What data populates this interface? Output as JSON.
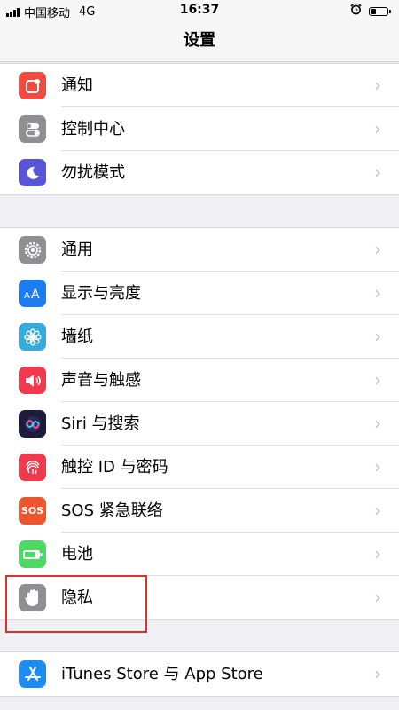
{
  "status_bar": {
    "carrier": "中国移动",
    "network": "4G",
    "time": "16:37",
    "alarm_icon": "alarm-clock-icon",
    "battery_level": 0.35
  },
  "nav": {
    "title": "设置"
  },
  "groups": [
    {
      "items": [
        {
          "label": "通知",
          "icon": "notification-icon",
          "color": "#f04b3f"
        },
        {
          "label": "控制中心",
          "icon": "toggles-icon",
          "color": "#8e8e93"
        },
        {
          "label": "勿扰模式",
          "icon": "moon-icon",
          "color": "#5856d6"
        }
      ]
    },
    {
      "items": [
        {
          "label": "通用",
          "icon": "gear-icon",
          "color": "#8e8e93"
        },
        {
          "label": "显示与亮度",
          "icon": "text-size-icon",
          "color": "#1d7cf2"
        },
        {
          "label": "墙纸",
          "icon": "flower-icon",
          "color": "#35aadc"
        },
        {
          "label": "声音与触感",
          "icon": "speaker-icon",
          "color": "#f1394e"
        },
        {
          "label": "Siri 与搜索",
          "icon": "siri-icon",
          "color": "#1c1c3a"
        },
        {
          "label": "触控 ID 与密码",
          "icon": "fingerprint-icon",
          "color": "#f0394c"
        },
        {
          "label": "SOS 紧急联络",
          "icon": "sos-icon",
          "color": "#f0542d",
          "icon_text": "SOS"
        },
        {
          "label": "电池",
          "icon": "battery-icon",
          "color": "#4cd964"
        },
        {
          "label": "隐私",
          "icon": "hand-icon",
          "color": "#8e8e93"
        }
      ]
    },
    {
      "items": [
        {
          "label": "iTunes Store 与 App Store",
          "icon": "app-store-icon",
          "color": "#1d8cf2"
        }
      ]
    }
  ],
  "chevron": "›",
  "annotation_color": "#d9322b"
}
